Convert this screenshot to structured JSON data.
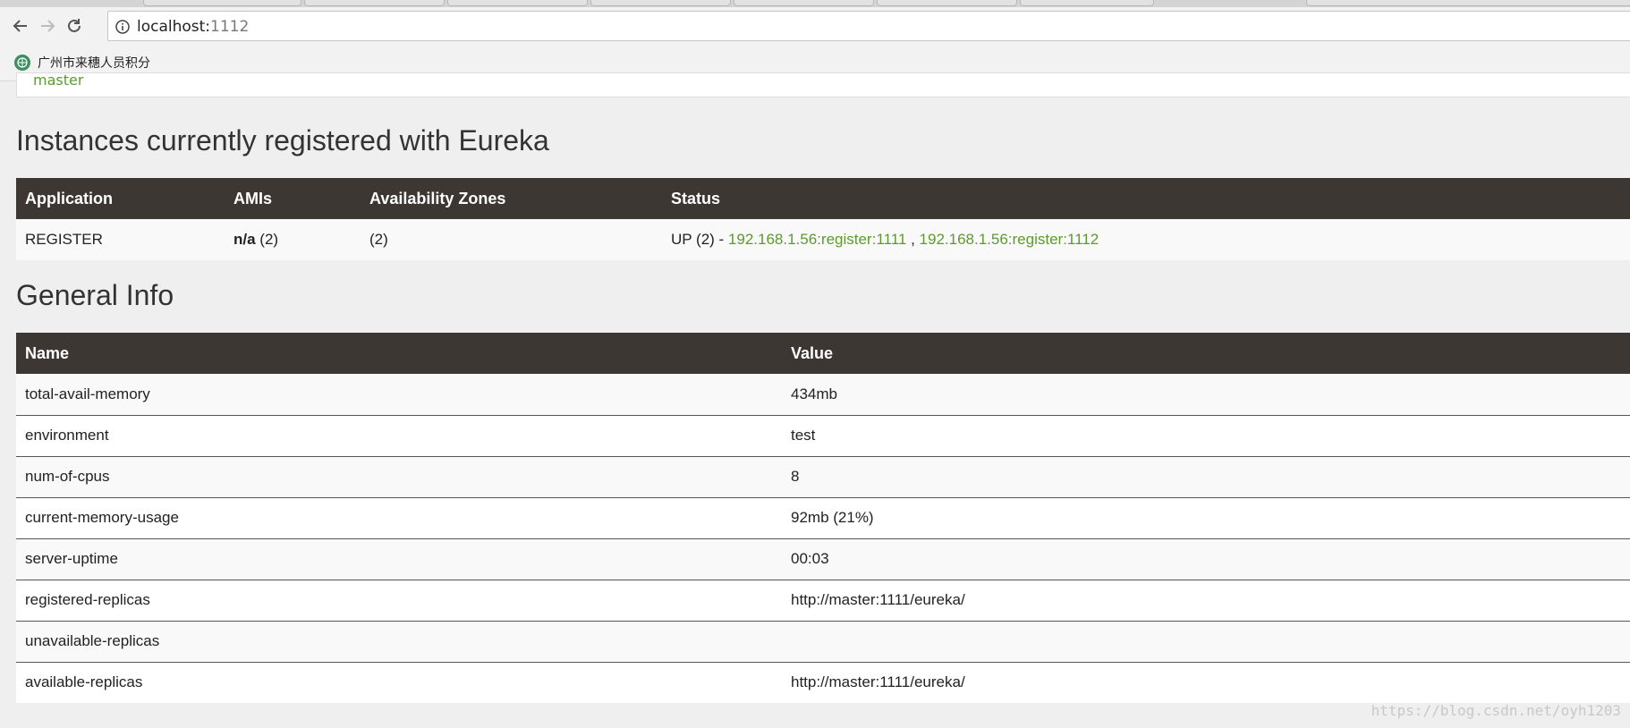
{
  "browser": {
    "url_host": "localhost:",
    "url_port": "1112",
    "bookmark_label": "广州市来穗人员积分"
  },
  "header_box": {
    "text": "master"
  },
  "instances": {
    "heading": "Instances currently registered with Eureka",
    "columns": [
      "Application",
      "AMIs",
      "Availability Zones",
      "Status"
    ],
    "rows": [
      {
        "application": "REGISTER",
        "amis_bold": "n/a",
        "amis_count": " (2)",
        "zones": "(2)",
        "status_prefix": "UP (2) - ",
        "link1": "192.168.1.56:register:1111",
        "separator": " , ",
        "link2": "192.168.1.56:register:1112"
      }
    ]
  },
  "general_info": {
    "heading": "General Info",
    "columns": [
      "Name",
      "Value"
    ],
    "rows": [
      {
        "name": "total-avail-memory",
        "value": "434mb"
      },
      {
        "name": "environment",
        "value": "test"
      },
      {
        "name": "num-of-cpus",
        "value": "8"
      },
      {
        "name": "current-memory-usage",
        "value": "92mb (21%)"
      },
      {
        "name": "server-uptime",
        "value": "00:03"
      },
      {
        "name": "registered-replicas",
        "value": "http://master:1111/eureka/"
      },
      {
        "name": "unavailable-replicas",
        "value": ""
      },
      {
        "name": "available-replicas",
        "value": "http://master:1111/eureka/"
      }
    ]
  },
  "watermark": "https://blog.csdn.net/oyh1203",
  "colors": {
    "header_bg": "#3c3733",
    "link_green": "#5c9a2e",
    "page_bg": "#efefef"
  }
}
